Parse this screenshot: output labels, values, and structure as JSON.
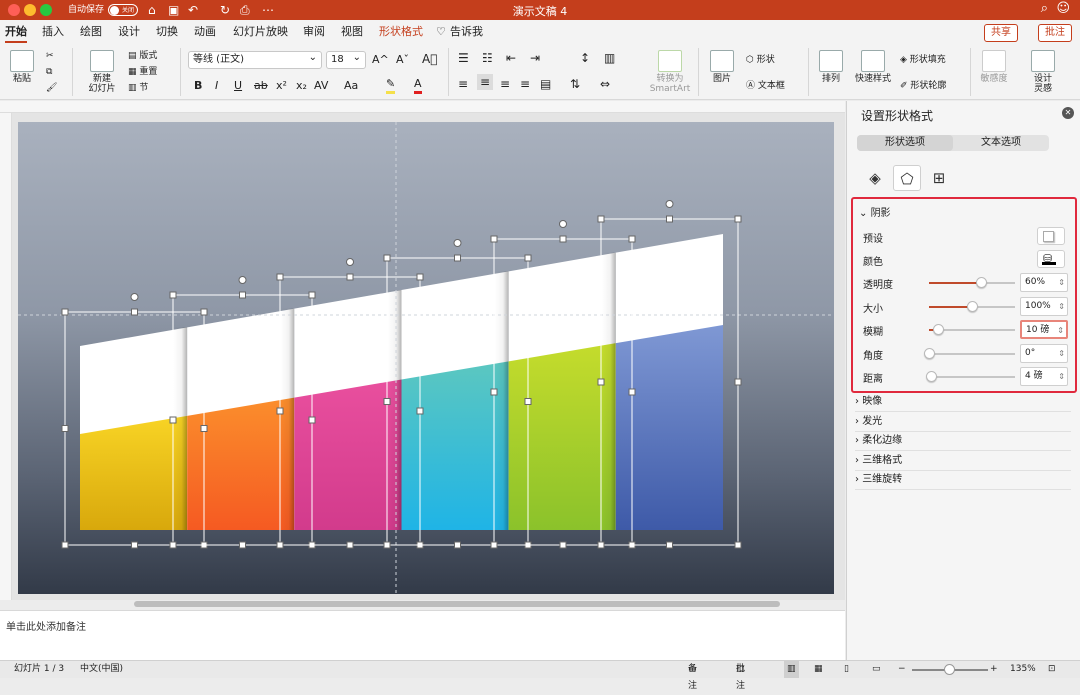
{
  "window": {
    "title": "演示文稿 4",
    "autosave_label": "自动保存",
    "autosave_state": "关闭"
  },
  "tabs": [
    "开始",
    "插入",
    "绘图",
    "设计",
    "切换",
    "动画",
    "幻灯片放映",
    "审阅",
    "视图",
    "形状格式",
    "告诉我"
  ],
  "actions": {
    "share": "共享",
    "comment": "批注"
  },
  "ribbon": {
    "paste": "粘贴",
    "new_slide": "新建\n幻灯片",
    "layout": "版式",
    "reset": "重置",
    "section": "节",
    "font_name": "等线 (正文)",
    "font_size": "18",
    "font_buttons": [
      "B",
      "I",
      "U",
      "ab",
      "x²",
      "x₂",
      "AV",
      "Aa"
    ],
    "convert_smartart": "转换为\nSmartArt",
    "picture": "图片",
    "shape": "形状",
    "textbox": "文本框",
    "arrange": "排列",
    "quick_styles": "快速样式",
    "shape_fill": "形状填充",
    "shape_outline": "形状轮廓",
    "sensitivity": "敏感度",
    "designer": "设计\n灵感"
  },
  "colors": {
    "accent": "#c43e1c",
    "highlight": "#e0293d"
  },
  "chart_colors": [
    "#f2c31a",
    "#f77b28",
    "#e0479a",
    "#2bb9d8",
    "#a6cf2a",
    "#5b7fc6"
  ],
  "notes_placeholder": "单击此处添加备注",
  "status": {
    "slide": "幻灯片 1 / 3",
    "language": "中文(中国)",
    "notes": "备注",
    "comments": "批注",
    "zoom": "135%"
  },
  "pane": {
    "title": "设置形状格式",
    "tabs": {
      "shape": "形状选项",
      "text": "文本选项"
    },
    "icons": [
      "fill-line-icon",
      "effects-pentagon-icon",
      "size-properties-icon"
    ],
    "shadow": {
      "header": "阴影",
      "preset_label": "预设",
      "color_label": "颜色",
      "rows": [
        {
          "label": "透明度",
          "value": "60%",
          "level": 0.6
        },
        {
          "label": "大小",
          "value": "100%",
          "level": 0.5
        },
        {
          "label": "模糊",
          "value": "10 磅",
          "level": 0.1
        },
        {
          "label": "角度",
          "value": "0°",
          "level": 0.0
        },
        {
          "label": "距离",
          "value": "4 磅",
          "level": 0.02
        }
      ]
    },
    "sections": [
      "映像",
      "发光",
      "柔化边缘",
      "三维格式",
      "三维旋转"
    ]
  }
}
